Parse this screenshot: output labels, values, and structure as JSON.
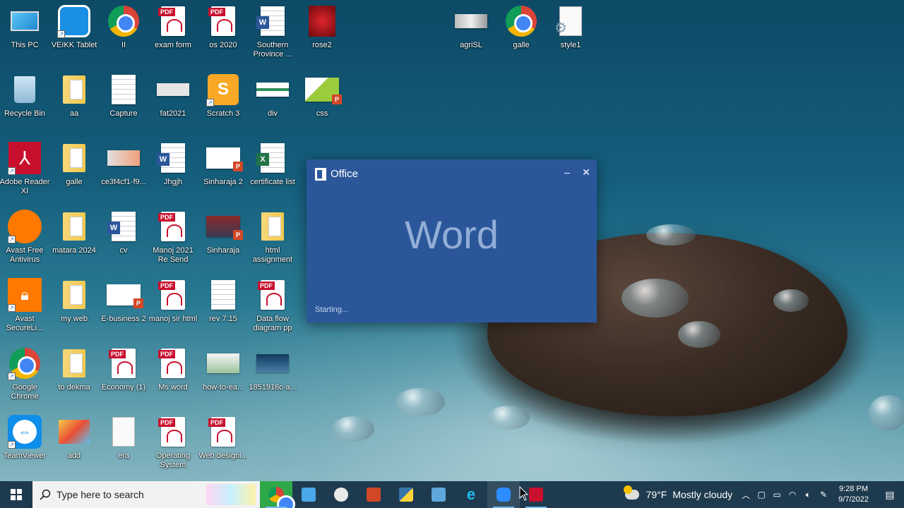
{
  "desktop": {
    "icons": [
      {
        "label": "This PC"
      },
      {
        "label": "VEIKK Tablet"
      },
      {
        "label": "II"
      },
      {
        "label": "exam form"
      },
      {
        "label": "os 2020"
      },
      {
        "label": "Southern Province ..."
      },
      {
        "label": "rose2"
      },
      {
        "label": "agriSL"
      },
      {
        "label": "galle"
      },
      {
        "label": "style1"
      },
      {
        "label": "Recycle Bin"
      },
      {
        "label": "aa"
      },
      {
        "label": "Capture"
      },
      {
        "label": "fat2021"
      },
      {
        "label": "Scratch 3"
      },
      {
        "label": "div"
      },
      {
        "label": "css"
      },
      {
        "label": "Adobe Reader XI"
      },
      {
        "label": "galle"
      },
      {
        "label": "ce3f4cf1-f9..."
      },
      {
        "label": "Jhgjh"
      },
      {
        "label": "Sinharaja 2"
      },
      {
        "label": "certificate list"
      },
      {
        "label": "Avast Free Antivirus"
      },
      {
        "label": "matara 2024"
      },
      {
        "label": "cv"
      },
      {
        "label": "Manoj 2021 Re Send"
      },
      {
        "label": "Sinharaja"
      },
      {
        "label": "html assignment"
      },
      {
        "label": "Avast SecureLi..."
      },
      {
        "label": "my web"
      },
      {
        "label": "E-business 2"
      },
      {
        "label": "manoj sir html"
      },
      {
        "label": "rev 7.15"
      },
      {
        "label": "Data flow diagram pp"
      },
      {
        "label": "Google Chrome"
      },
      {
        "label": "to dekma"
      },
      {
        "label": "Economy (1)"
      },
      {
        "label": "Ms word"
      },
      {
        "label": "how-to-ea..."
      },
      {
        "label": "1851916c-a..."
      },
      {
        "label": "TeamViewer"
      },
      {
        "label": "add"
      },
      {
        "label": "era"
      },
      {
        "label": "Operating System"
      },
      {
        "label": "Web designi..."
      }
    ]
  },
  "splash": {
    "brand": "Office",
    "app_name": "Word",
    "status": "Starting...",
    "minimize": "–",
    "close": "✕",
    "bg_color": "#2b579a"
  },
  "taskbar": {
    "search_placeholder": "Type here to search",
    "weather_temp": "79°F",
    "weather_text": "Mostly cloudy",
    "time": "9:28 PM",
    "date": "9/7/2022",
    "tray_chevron": "︿",
    "notification_icon": "▤"
  }
}
